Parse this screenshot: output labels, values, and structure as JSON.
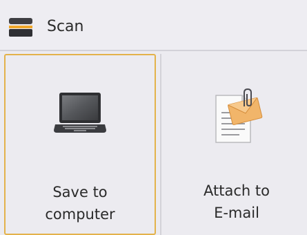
{
  "header": {
    "title": "Scan",
    "icon": "scanner-icon"
  },
  "tiles": [
    {
      "icon": "laptop-icon",
      "label_line1": "Save to",
      "label_line2": "computer",
      "selected": true
    },
    {
      "icon": "email-attachment-icon",
      "label_line1": "Attach to",
      "label_line2": "E-mail",
      "selected": false
    }
  ],
  "colors": {
    "selection_border": "#e3b24a",
    "background": "#ecebf0"
  }
}
